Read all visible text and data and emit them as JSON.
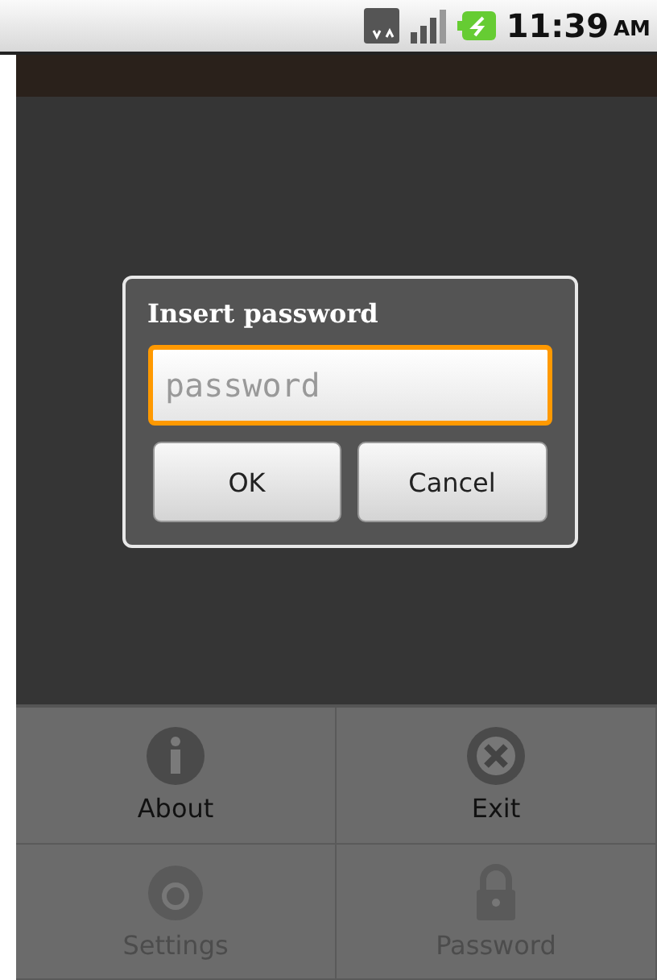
{
  "status_bar": {
    "time": "11:39",
    "ampm": "AM"
  },
  "dialog": {
    "title": "Insert password",
    "field": {
      "placeholder": "password",
      "focused": true
    },
    "buttons": [
      "OK",
      "Cancel"
    ]
  },
  "menu": [
    {
      "label": "About",
      "disabled": false
    },
    {
      "label": "Exit",
      "disabled": false
    },
    {
      "label": "Settings",
      "disabled": true
    },
    {
      "label": "Password",
      "disabled": true
    }
  ]
}
